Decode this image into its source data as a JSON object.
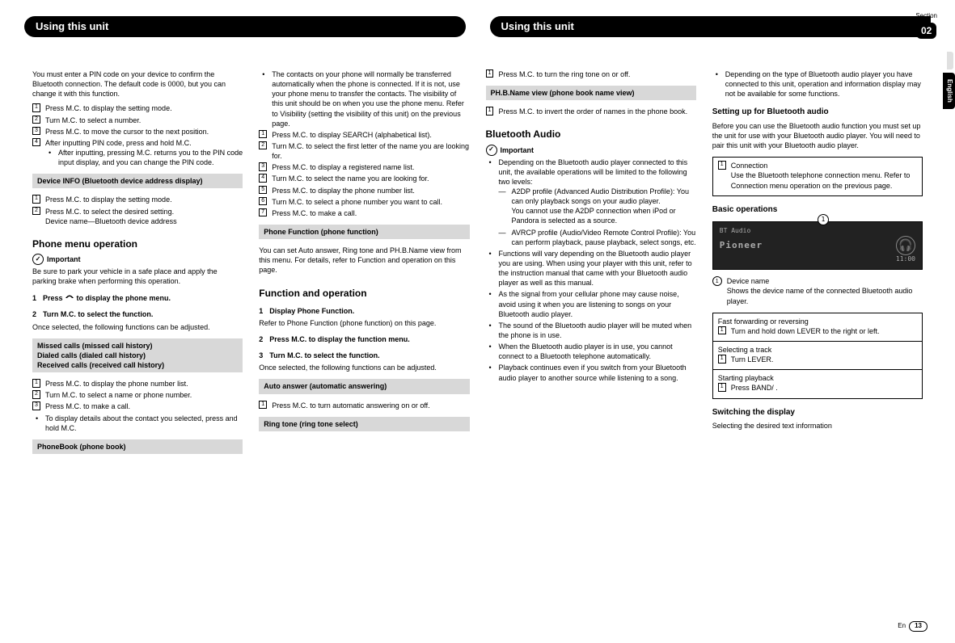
{
  "header": {
    "left_title": "Using this unit",
    "right_title": "Using this unit",
    "section_label": "Section",
    "section_num": "02",
    "lang": "English"
  },
  "col1": {
    "intro": "You must enter a PIN code on your device to confirm the Bluetooth connection. The default code is 0000, but you can change it with this function.",
    "steps1": [
      "Press M.C. to display the setting mode.",
      "Turn M.C. to select a number.",
      "Press M.C. to move the cursor to the next position.",
      "After inputting PIN code, press and hold M.C."
    ],
    "bullet1": "After inputting, pressing M.C. returns you to the PIN code input display, and you can change the PIN code.",
    "box1": "Device INFO (Bluetooth device address display)",
    "steps2": [
      "Press M.C. to display the setting mode.",
      "Press M.C. to select the desired setting."
    ],
    "steps2_sub": "Device name—Bluetooth device address",
    "h2": "Phone menu operation",
    "important": "Important",
    "important_text": "Be sure to park your vehicle in a safe place and apply the parking brake when performing this operation.",
    "step1": "Press         to display the phone menu.",
    "step2": "Turn M.C. to select the function.",
    "step2_sub": "Once selected, the following functions can be adjusted.",
    "box2_l1": "Missed calls (missed call history)",
    "box2_l2": "Dialed  calls (dialed call history)",
    "box2_l3": "Received calls (received call history)",
    "steps3": [
      "Press M.C. to display the phone number list.",
      "Turn M.C. to select a name or phone number.",
      "Press M.C. to make a call."
    ],
    "bullet3": "To display details about the contact you selected, press and hold M.C.",
    "box3": "PhoneBook (phone book)"
  },
  "col2": {
    "bullet1": "The contacts on your phone will normally be transferred automatically when the phone is connected. If it is not, use your phone menu to transfer the contacts. The visibility of this unit should be on when you use the phone menu. Refer to Visibility (setting the visibility of this unit) on the previous page.",
    "steps1": [
      "Press M.C. to display SEARCH (alphabetical list).",
      "Turn M.C. to select the first letter of the name you are looking for.",
      "Press M.C. to display a registered name list.",
      "Turn M.C. to select the name you are looking for.",
      "Press M.C. to display the phone number list.",
      "Turn M.C. to select a phone number you want to call.",
      "Press M.C. to make a call."
    ],
    "box1": "Phone Function (phone function)",
    "box1_after": "You can set Auto answer, Ring tone and PH.B.Name view from this menu. For details, refer to Function and operation on this page.",
    "h2": "Function and operation",
    "step1": "Display Phone Function.",
    "step1_sub": "Refer to Phone Function (phone function) on this page.",
    "step2": "Press M.C. to display the function menu.",
    "step3": "Turn M.C. to select the function.",
    "step3_sub": "Once selected, the following functions can be adjusted.",
    "box2": "Auto answer (automatic answering)",
    "steps2": [
      "Press M.C. to turn automatic answering on or off."
    ],
    "box3": "Ring tone (ring tone select)"
  },
  "col3": {
    "steps1": [
      "Press M.C. to turn the ring tone on or off."
    ],
    "box1": "PH.B.Name view (phone book name view)",
    "steps2": [
      "Press M.C. to invert the order of names in the phone book."
    ],
    "h2": "Bluetooth Audio",
    "important": "Important",
    "bul1": "Depending on the Bluetooth audio player connected to this unit, the available operations will be limited to the following two levels:",
    "dash1": "A2DP profile (Advanced Audio Distribution Profile): You can only playback songs on your audio player.",
    "dash1b": "You cannot use the A2DP connection when iPod or Pandora is selected as a source.",
    "dash2": "AVRCP profile (Audio/Video Remote Control Profile): You can perform playback, pause playback, select songs, etc.",
    "bul2": "Functions will vary depending on the Bluetooth audio player you are using. When using your player with this unit, refer to the instruction manual that came with your Bluetooth audio player as well as this manual.",
    "bul3": "As the signal from your cellular phone may cause noise, avoid using it when you are listening to songs on your Bluetooth audio player.",
    "bul4": "The sound of the Bluetooth audio player will be muted when the phone is in use.",
    "bul5": "When the Bluetooth audio player is in use, you cannot connect to a Bluetooth telephone automatically.",
    "bul6": "Playback continues even if you switch from your Bluetooth audio player to another source while listening to a song."
  },
  "col4": {
    "bul1": "Depending on the type of Bluetooth audio player you have connected to this unit, operation and information display may not be available for some functions.",
    "h3a": "Setting up for Bluetooth audio",
    "p1": "Before you can use the Bluetooth audio function you must set up the unit for use with your Bluetooth audio player. You will need to pair this unit with your Bluetooth audio player.",
    "tbl1_head": "Connection",
    "tbl1_body": "Use the Bluetooth telephone connection menu. Refer to Connection menu operation on the previous page.",
    "h3b": "Basic operations",
    "display": {
      "label": "BT Audio",
      "brand": "Pioneer",
      "time": "11:00",
      "callout": "1"
    },
    "callout_num": "1",
    "callout_title": "Device name",
    "callout_body": "Shows the device name of the connected Bluetooth audio player.",
    "op1_t": "Fast forwarding or reversing",
    "op1_b": "Turn and hold down LEVER to the right or left.",
    "op2_t": "Selecting a track",
    "op2_b": "Turn LEVER.",
    "op3_t": "Starting playback",
    "op3_b": "Press BAND/      .",
    "h3c": "Switching the display",
    "p3": "Selecting the desired text information"
  },
  "footer": {
    "lang": "En",
    "page": "13"
  }
}
